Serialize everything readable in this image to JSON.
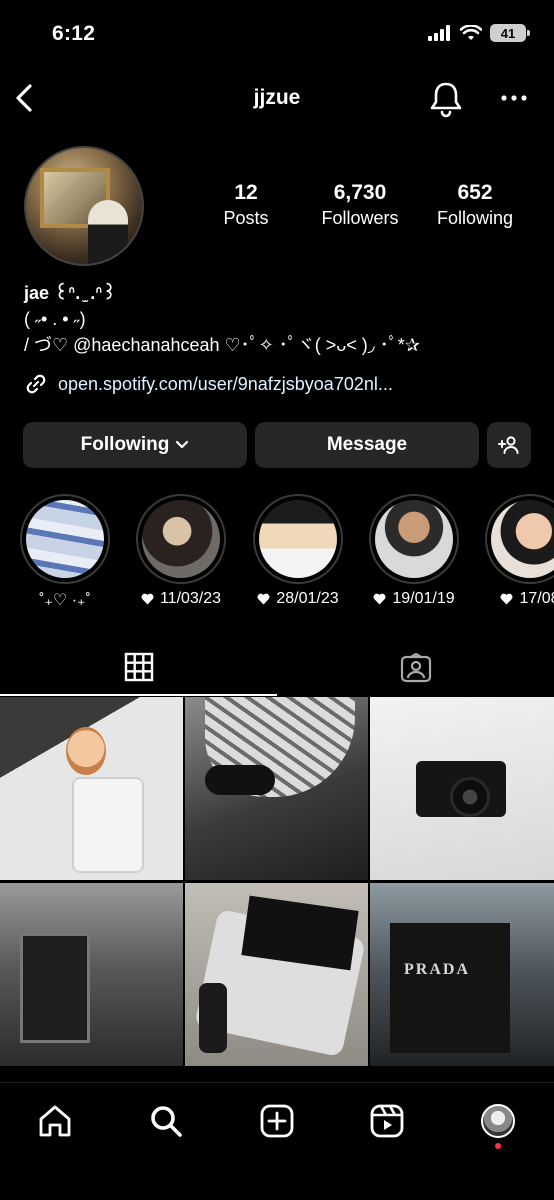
{
  "status_bar": {
    "time": "6:12",
    "battery": "41",
    "icons": [
      "signal-icon",
      "wifi-icon",
      "battery-icon"
    ]
  },
  "header": {
    "username": "jjzue",
    "back_icon": "chevron-left-icon",
    "bell_icon": "bell-icon",
    "more_icon": "more-icon"
  },
  "profile": {
    "stats": [
      {
        "value": "12",
        "label": "Posts"
      },
      {
        "value": "6,730",
        "label": "Followers"
      },
      {
        "value": "652",
        "label": "Following"
      }
    ],
    "bio": {
      "name": "jae ꒰ᐢ. ̫ .ᐢ꒱",
      "line2": "( ˶•  .  • ˶)",
      "line3": "/    づ♡ @haechanahceah ♡･ﾟ✧ ･ﾟヾ(⁠ ˃ᴗ˂ ⁠)◞ ･ﾟ*✰"
    },
    "link": "open.spotify.com/user/9nafzjsbyoa702nl..."
  },
  "actions": {
    "following": "Following",
    "message": "Message"
  },
  "highlights": [
    {
      "caption": "˚₊♡ ·₊˚",
      "heart": false
    },
    {
      "caption": "11/03/23",
      "heart": true
    },
    {
      "caption": "28/01/23",
      "heart": true
    },
    {
      "caption": "19/01/19",
      "heart": true
    },
    {
      "caption": "17/08",
      "heart": true
    }
  ],
  "posts": {
    "store_sign": "PRADA"
  },
  "accent": {
    "background": "#000000",
    "button": "#262626",
    "notification_dot": "#ff3040"
  }
}
